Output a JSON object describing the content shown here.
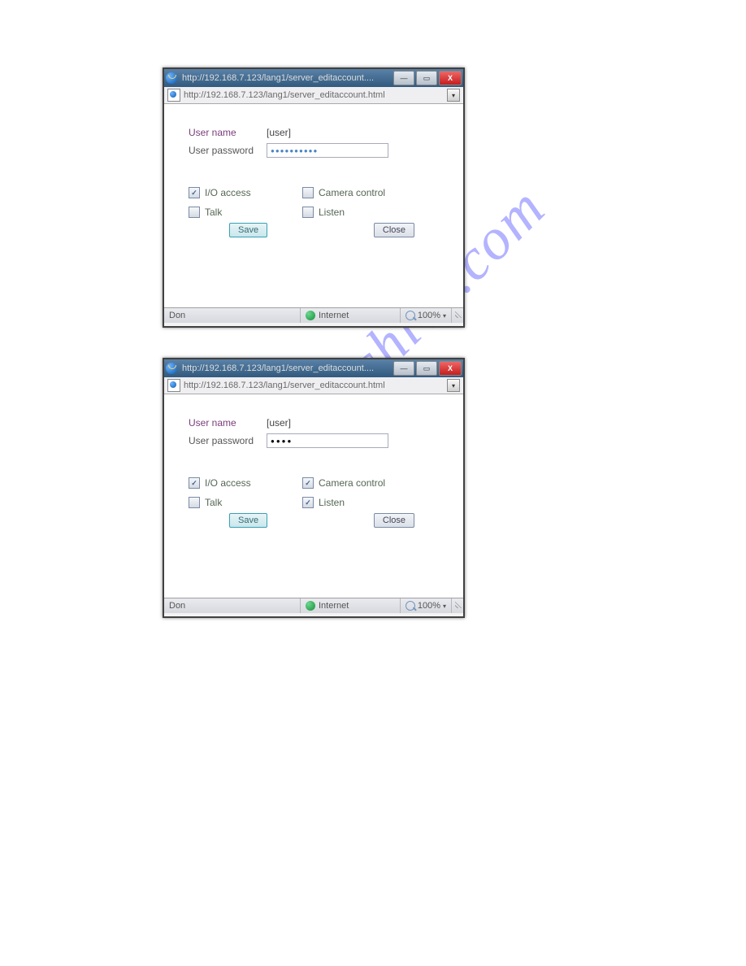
{
  "watermark": "manualshive.com",
  "windows": [
    {
      "title": "http://192.168.7.123/lang1/server_editaccount....",
      "address": "http://192.168.7.123/lang1/server_editaccount.html",
      "form": {
        "username_label": "User name",
        "username_value": "[user]",
        "password_label": "User password",
        "password_masked": "●●●●●●●●●●",
        "checkboxes": {
          "io_label": "I/O access",
          "io_checked": true,
          "camera_label": "Camera control",
          "camera_checked": false,
          "talk_label": "Talk",
          "talk_checked": false,
          "listen_label": "Listen",
          "listen_checked": false
        },
        "save_label": "Save",
        "close_label": "Close"
      },
      "status": {
        "left": "Don",
        "zone": "Internet",
        "zoom": "100%"
      }
    },
    {
      "title": "http://192.168.7.123/lang1/server_editaccount....",
      "address": "http://192.168.7.123/lang1/server_editaccount.html",
      "form": {
        "username_label": "User name",
        "username_value": "[user]",
        "password_label": "User password",
        "password_masked": "●●●●",
        "checkboxes": {
          "io_label": "I/O access",
          "io_checked": true,
          "camera_label": "Camera control",
          "camera_checked": true,
          "talk_label": "Talk",
          "talk_checked": false,
          "listen_label": "Listen",
          "listen_checked": true
        },
        "save_label": "Save",
        "close_label": "Close"
      },
      "status": {
        "left": "Don",
        "zone": "Internet",
        "zoom": "100%"
      }
    }
  ]
}
